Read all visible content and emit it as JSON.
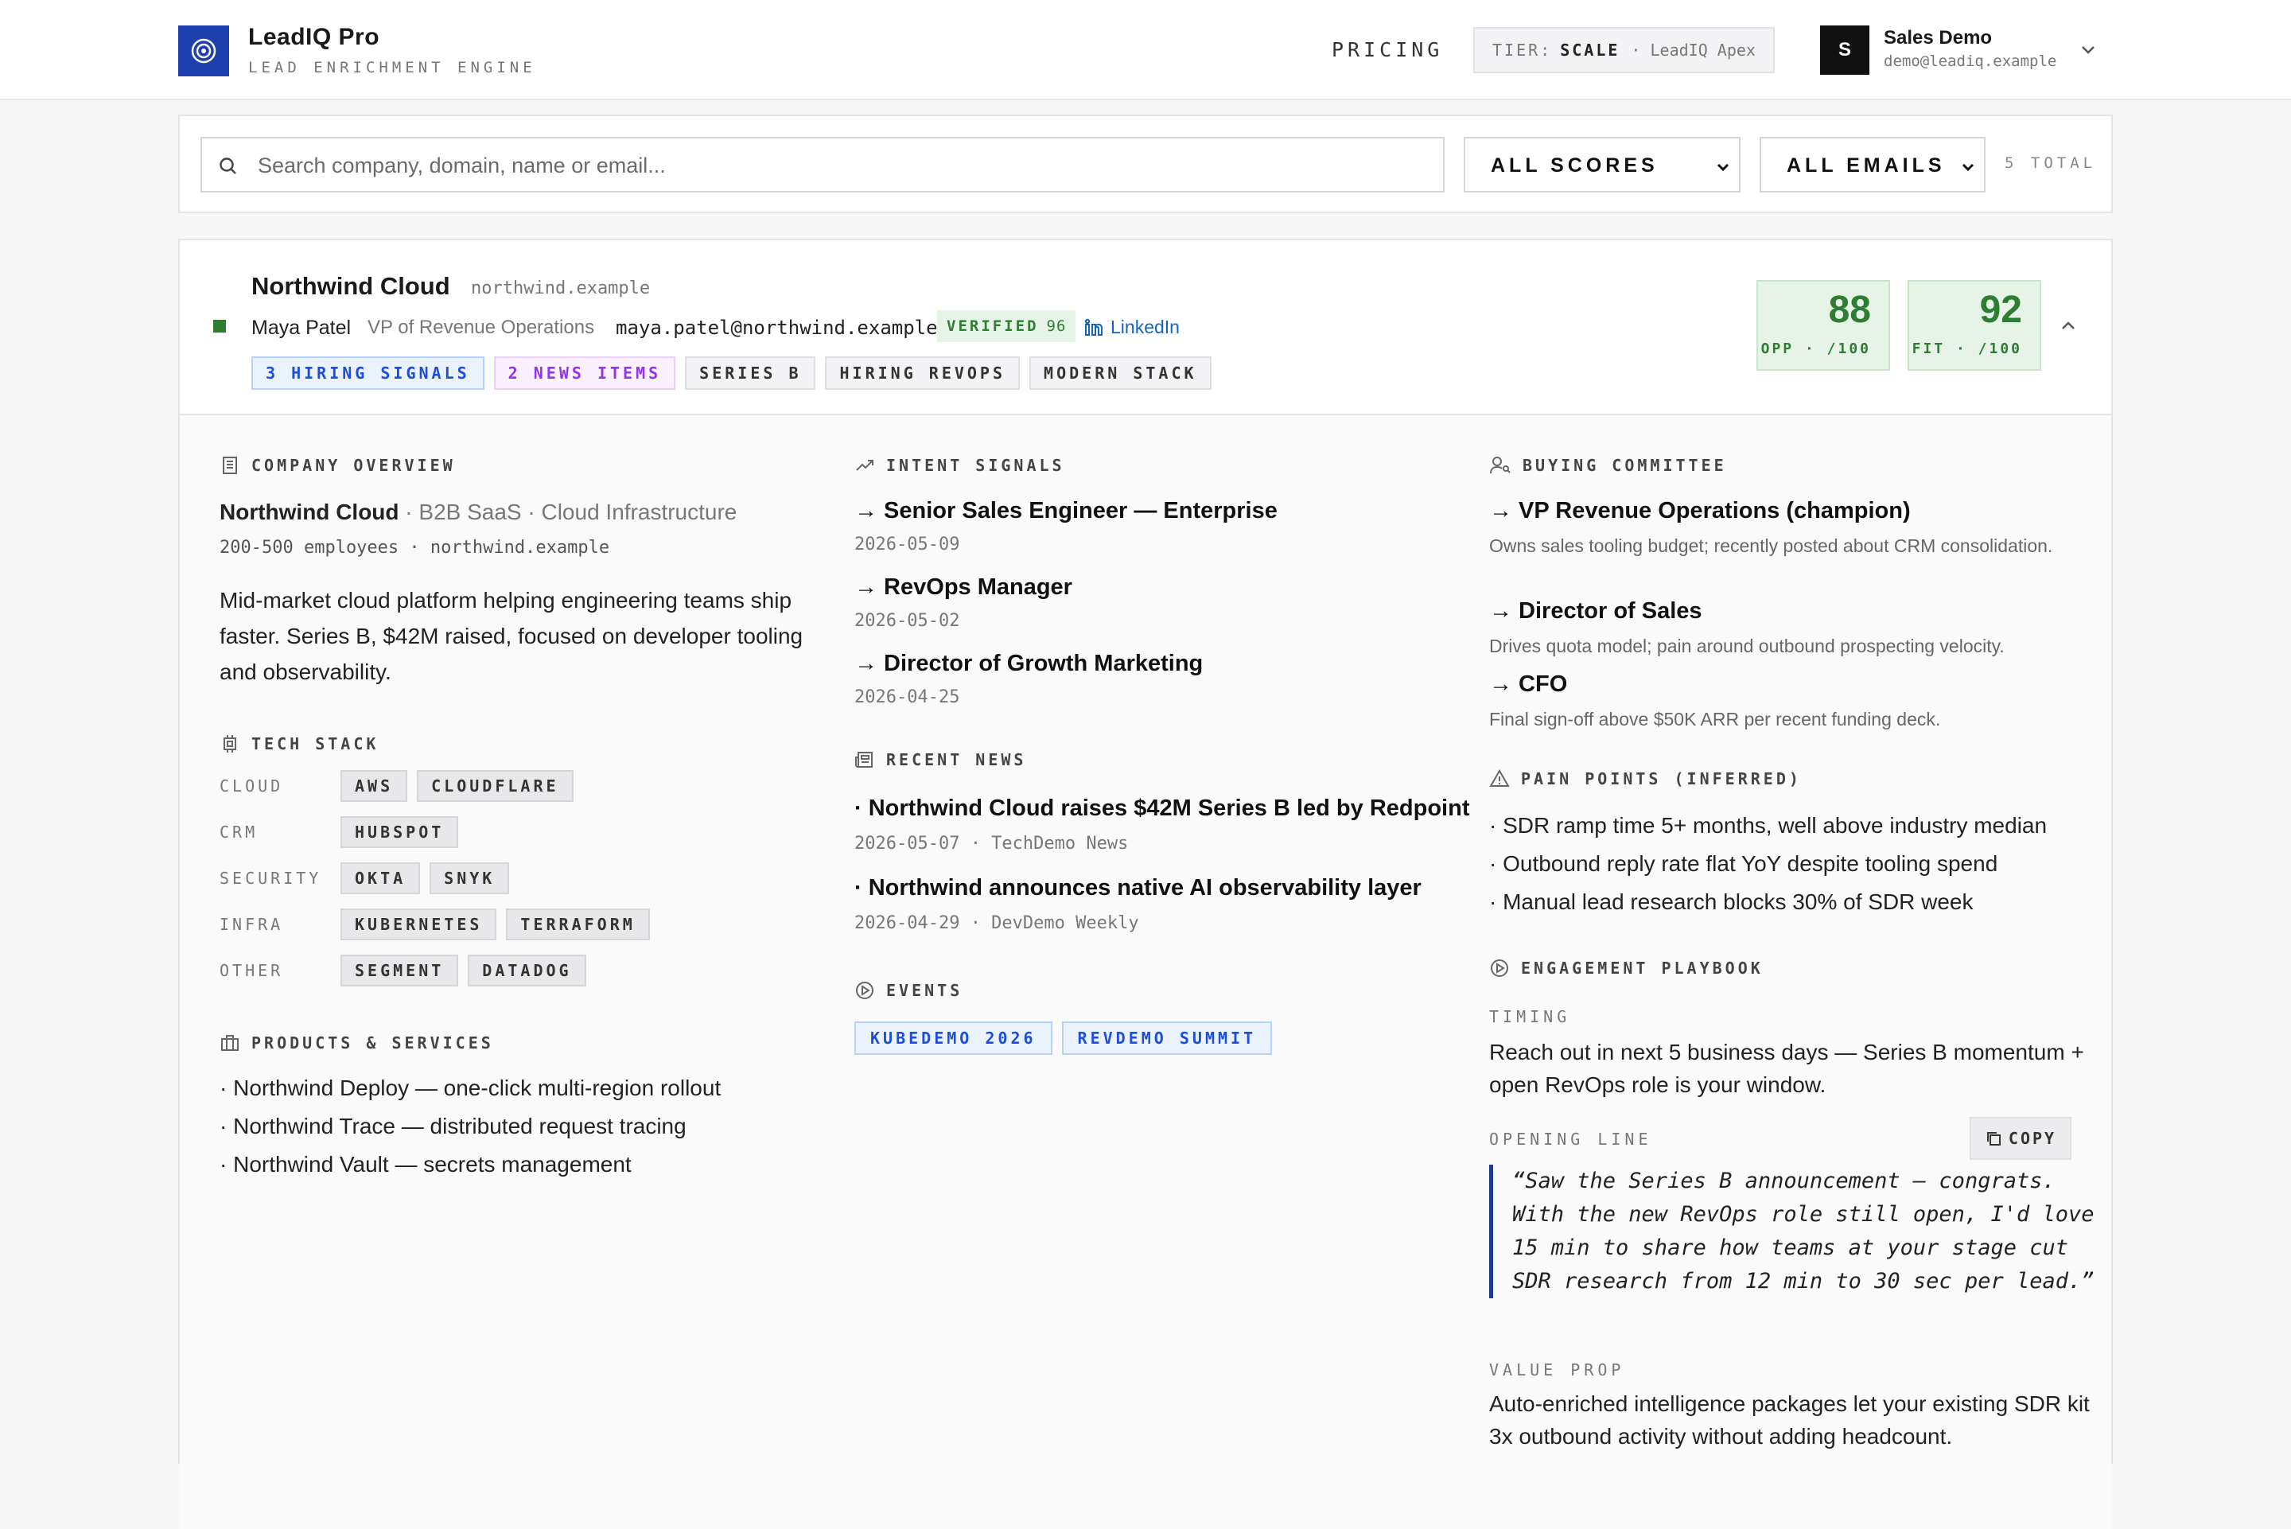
{
  "header": {
    "brand_name": "LeadIQ Pro",
    "brand_sub": "LEAD ENRICHMENT ENGINE",
    "pricing": "PRICING",
    "tier_label": "TIER:",
    "tier_value": "SCALE",
    "tier_plan": "· LeadIQ Apex",
    "user_initial": "S",
    "user_name": "Sales Demo",
    "user_email": "demo@leadiq.example"
  },
  "filters": {
    "search_placeholder": "Search company, domain, name or email...",
    "score_select": "ALL SCORES",
    "email_select": "ALL EMAILS",
    "total": "5 TOTAL"
  },
  "lead": {
    "company": "Northwind Cloud",
    "domain": "northwind.example",
    "contact_name": "Maya Patel",
    "contact_role": "VP of Revenue Operations",
    "contact_email": "maya.patel@northwind.example",
    "verified_label": "VERIFIED",
    "verified_score": "96",
    "linkedin": "LinkedIn",
    "chips": [
      "3 HIRING SIGNALS",
      "2 NEWS ITEMS",
      "SERIES B",
      "HIRING REVOPS",
      "MODERN STACK"
    ],
    "opp_score": "88",
    "opp_label": "OPP · /100",
    "fit_score": "92",
    "fit_label": "FIT · /100"
  },
  "overview": {
    "title": "COMPANY OVERVIEW",
    "company": "Northwind Cloud",
    "category": " · B2B SaaS · Cloud Infrastructure",
    "meta": "200-500 employees · northwind.example",
    "description": "Mid-market cloud platform helping engineering teams ship faster. Series B, $42M raised, focused on developer tooling and observability."
  },
  "tech_stack": {
    "title": "TECH STACK",
    "rows": [
      {
        "label": "CLOUD",
        "items": [
          "AWS",
          "CLOUDFLARE"
        ]
      },
      {
        "label": "CRM",
        "items": [
          "HUBSPOT"
        ]
      },
      {
        "label": "SECURITY",
        "items": [
          "OKTA",
          "SNYK"
        ]
      },
      {
        "label": "INFRA",
        "items": [
          "KUBERNETES",
          "TERRAFORM"
        ]
      },
      {
        "label": "OTHER",
        "items": [
          "SEGMENT",
          "DATADOG"
        ]
      }
    ]
  },
  "products": {
    "title": "PRODUCTS & SERVICES",
    "items": [
      "· Northwind Deploy — one-click multi-region rollout",
      "· Northwind Trace — distributed request tracing",
      "· Northwind Vault — secrets management"
    ]
  },
  "intent": {
    "title": "INTENT SIGNALS",
    "items": [
      {
        "title": "→ Senior Sales Engineer — Enterprise",
        "date": "2026-05-09"
      },
      {
        "title": "→ RevOps Manager",
        "date": "2026-05-02"
      },
      {
        "title": "→ Director of Growth Marketing",
        "date": "2026-04-25"
      }
    ]
  },
  "news": {
    "title": "RECENT NEWS",
    "items": [
      {
        "title": "· Northwind Cloud raises $42M Series B led by Redpoint",
        "meta": "2026-05-07 · TechDemo News"
      },
      {
        "title": "· Northwind announces native AI observability layer",
        "meta": "2026-04-29 · DevDemo Weekly"
      }
    ]
  },
  "events": {
    "title": "EVENTS",
    "items": [
      "KUBEDEMO 2026",
      "REVDEMO SUMMIT"
    ]
  },
  "buying_committee": {
    "title": "BUYING COMMITTEE",
    "items": [
      {
        "title": "→ VP Revenue Operations (champion)",
        "desc": "Owns sales tooling budget; recently posted about CRM consolidation."
      },
      {
        "title": "→ Director of Sales",
        "desc": "Drives quota model; pain around outbound prospecting velocity."
      },
      {
        "title": "→ CFO",
        "desc": "Final sign-off above $50K ARR per recent funding deck."
      }
    ]
  },
  "pain_points": {
    "title": "PAIN POINTS (INFERRED)",
    "items": [
      "· SDR ramp time 5+ months, well above industry median",
      "· Outbound reply rate flat YoY despite tooling spend",
      "· Manual lead research blocks 30% of SDR week"
    ]
  },
  "playbook": {
    "title": "ENGAGEMENT PLAYBOOK",
    "timing_label": "TIMING",
    "timing_text": "Reach out in next 5 business days — Series B momentum + open RevOps role is your window.",
    "opening_label": "OPENING LINE",
    "copy": "COPY",
    "opening_text": "“Saw the Series B announcement — congrats. With the new RevOps role still open, I'd love 15 min to share how teams at your stage cut SDR research from 12 min to 30 sec per lead.”",
    "value_label": "VALUE PROP",
    "value_text": "Auto-enriched intelligence packages let your existing SDR kit 3x outbound activity without adding headcount."
  },
  "colors": {
    "brand": "#1e40af",
    "score_green": "#2e7d32",
    "link_blue": "#1565c0"
  }
}
